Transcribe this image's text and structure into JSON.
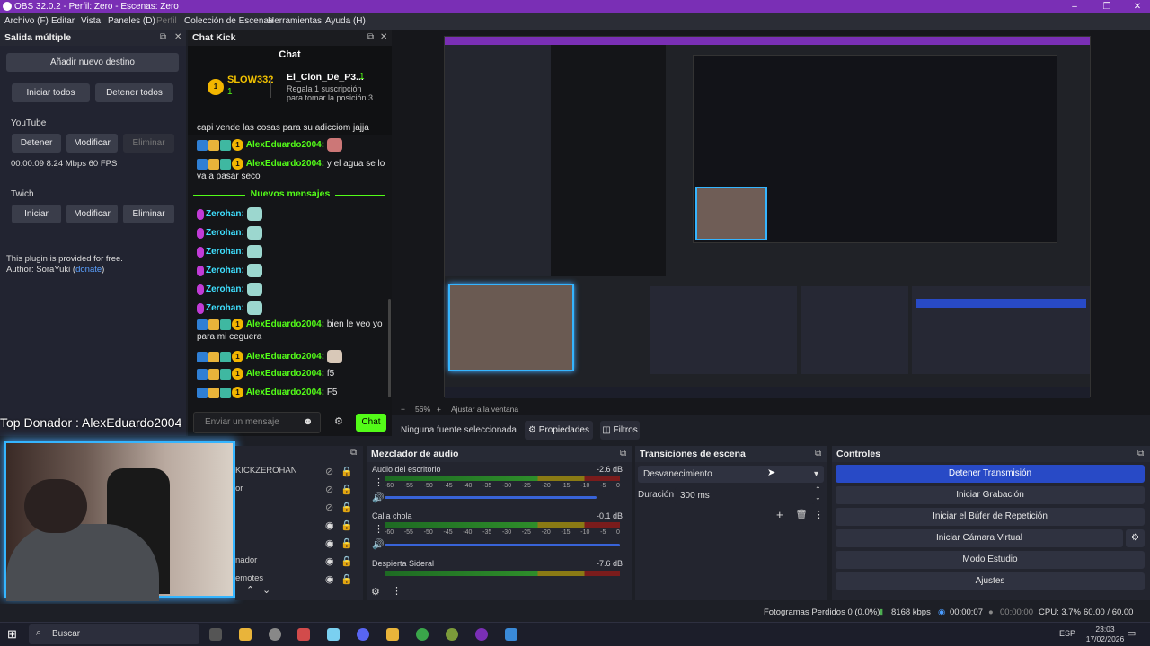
{
  "window": {
    "title": "OBS 32.0.2 - Perfil: Zero - Escenas: Zero"
  },
  "menu": [
    "Archivo (F)",
    "Editar",
    "Vista",
    "Paneles (D)",
    "Perfil",
    "Colección de Escenas",
    "Herramientas",
    "Ayuda (H)"
  ],
  "multi_output": {
    "title": "Salida múltiple",
    "add_dest": "Añadir nuevo destino",
    "start_all": "Iniciar todos",
    "stop_all": "Detener todos",
    "youtube": {
      "label": "YouTube",
      "stop": "Detener",
      "modify": "Modificar",
      "delete": "Eliminar",
      "stats": "00:00:09  8.24 Mbps  60 FPS"
    },
    "twitch": {
      "label": "Twich",
      "start": "Iniciar",
      "modify": "Modificar",
      "delete": "Eliminar"
    },
    "plugin_note": "This plugin is provided for free.",
    "author_prefix": "Author: SoraYuki (",
    "author_link": "donate",
    "author_suffix": ")"
  },
  "chat_dock": {
    "title": "Chat Kick",
    "header": "Chat",
    "top_user": "SLOW332",
    "top_user_count": "1",
    "top_rank": "1",
    "clon_user": "El_Clon_De_P3...",
    "clon_count": "1",
    "gift_line1": "Regala 1 suscripción",
    "gift_line2": "para tomar la posición 3",
    "cut_line": "capi vende las cosas para su adicciom jajja",
    "msgs": [
      {
        "user": "AlexEduardo2004:",
        "text": ""
      },
      {
        "user": "AlexEduardo2004:",
        "text": "y el agua se lo va a pasar seco"
      }
    ],
    "new_messages": "Nuevos mensajes",
    "zerohan": [
      "Zerohan:",
      "Zerohan:",
      "Zerohan:",
      "Zerohan:",
      "Zerohan:",
      "Zerohan:"
    ],
    "msgs2": [
      {
        "user": "AlexEduardo2004:",
        "text": "bien le veo yo para mi ceguera"
      },
      {
        "user": "AlexEduardo2004:",
        "text": ""
      },
      {
        "user": "AlexEduardo2004:",
        "text": "f5"
      },
      {
        "user": "AlexEduardo2004:",
        "text": "F5"
      }
    ],
    "input_placeholder": "Enviar un mensaje",
    "send": "Chat"
  },
  "overlay": {
    "donor": "Top Donador : AlexEduardo2004"
  },
  "preview": {
    "zoom": "56%",
    "fit": "Ajustar a la ventana"
  },
  "source_bar": {
    "none_selected": "Ninguna fuente seleccionada",
    "properties": "Propiedades",
    "filters": "Filtros"
  },
  "sources": {
    "items": [
      "KICKZEROHAN",
      "or",
      "",
      "",
      "",
      "nador",
      "emotes"
    ]
  },
  "mixer": {
    "title": "Mezclador de audio",
    "channels": [
      {
        "name": "Audio del escritorio",
        "db": "-2.6 dB",
        "level": 0.9
      },
      {
        "name": "Calla chola",
        "db": "-0.1 dB",
        "level": 1.0
      },
      {
        "name": "Despierta Sideral",
        "db": "-7.6 dB",
        "level": 0.8
      }
    ],
    "scale": [
      "-60",
      "-55",
      "-50",
      "-45",
      "-40",
      "-35",
      "-30",
      "-25",
      "-20",
      "-15",
      "-10",
      "-5",
      "0"
    ]
  },
  "transitions": {
    "title": "Transiciones de escena",
    "type": "Desvanecimiento",
    "duration_label": "Duración",
    "duration": "300 ms"
  },
  "controls": {
    "title": "Controles",
    "buttons": [
      "Detener Transmisión",
      "Iniciar Grabación",
      "Iniciar el Búfer de Repetición",
      "Iniciar Cámara Virtual",
      "Modo Estudio",
      "Ajustes"
    ]
  },
  "status": {
    "dropped": "Fotogramas Perdidos 0 (0.0%)",
    "bitrate": "8168 kbps",
    "stream_time": "00:00:07",
    "rec_time": "00:00:00",
    "cpu": "CPU: 3.7%",
    "fps": "60.00 / 60.00 FPS"
  },
  "taskbar": {
    "search": "Buscar",
    "lang": "ESP",
    "time": "23:03",
    "date": "17/02/2026"
  },
  "colors": {
    "accent": "#7a2fb5",
    "kick_green": "#53fc18",
    "active_blue": "#284ac6"
  }
}
